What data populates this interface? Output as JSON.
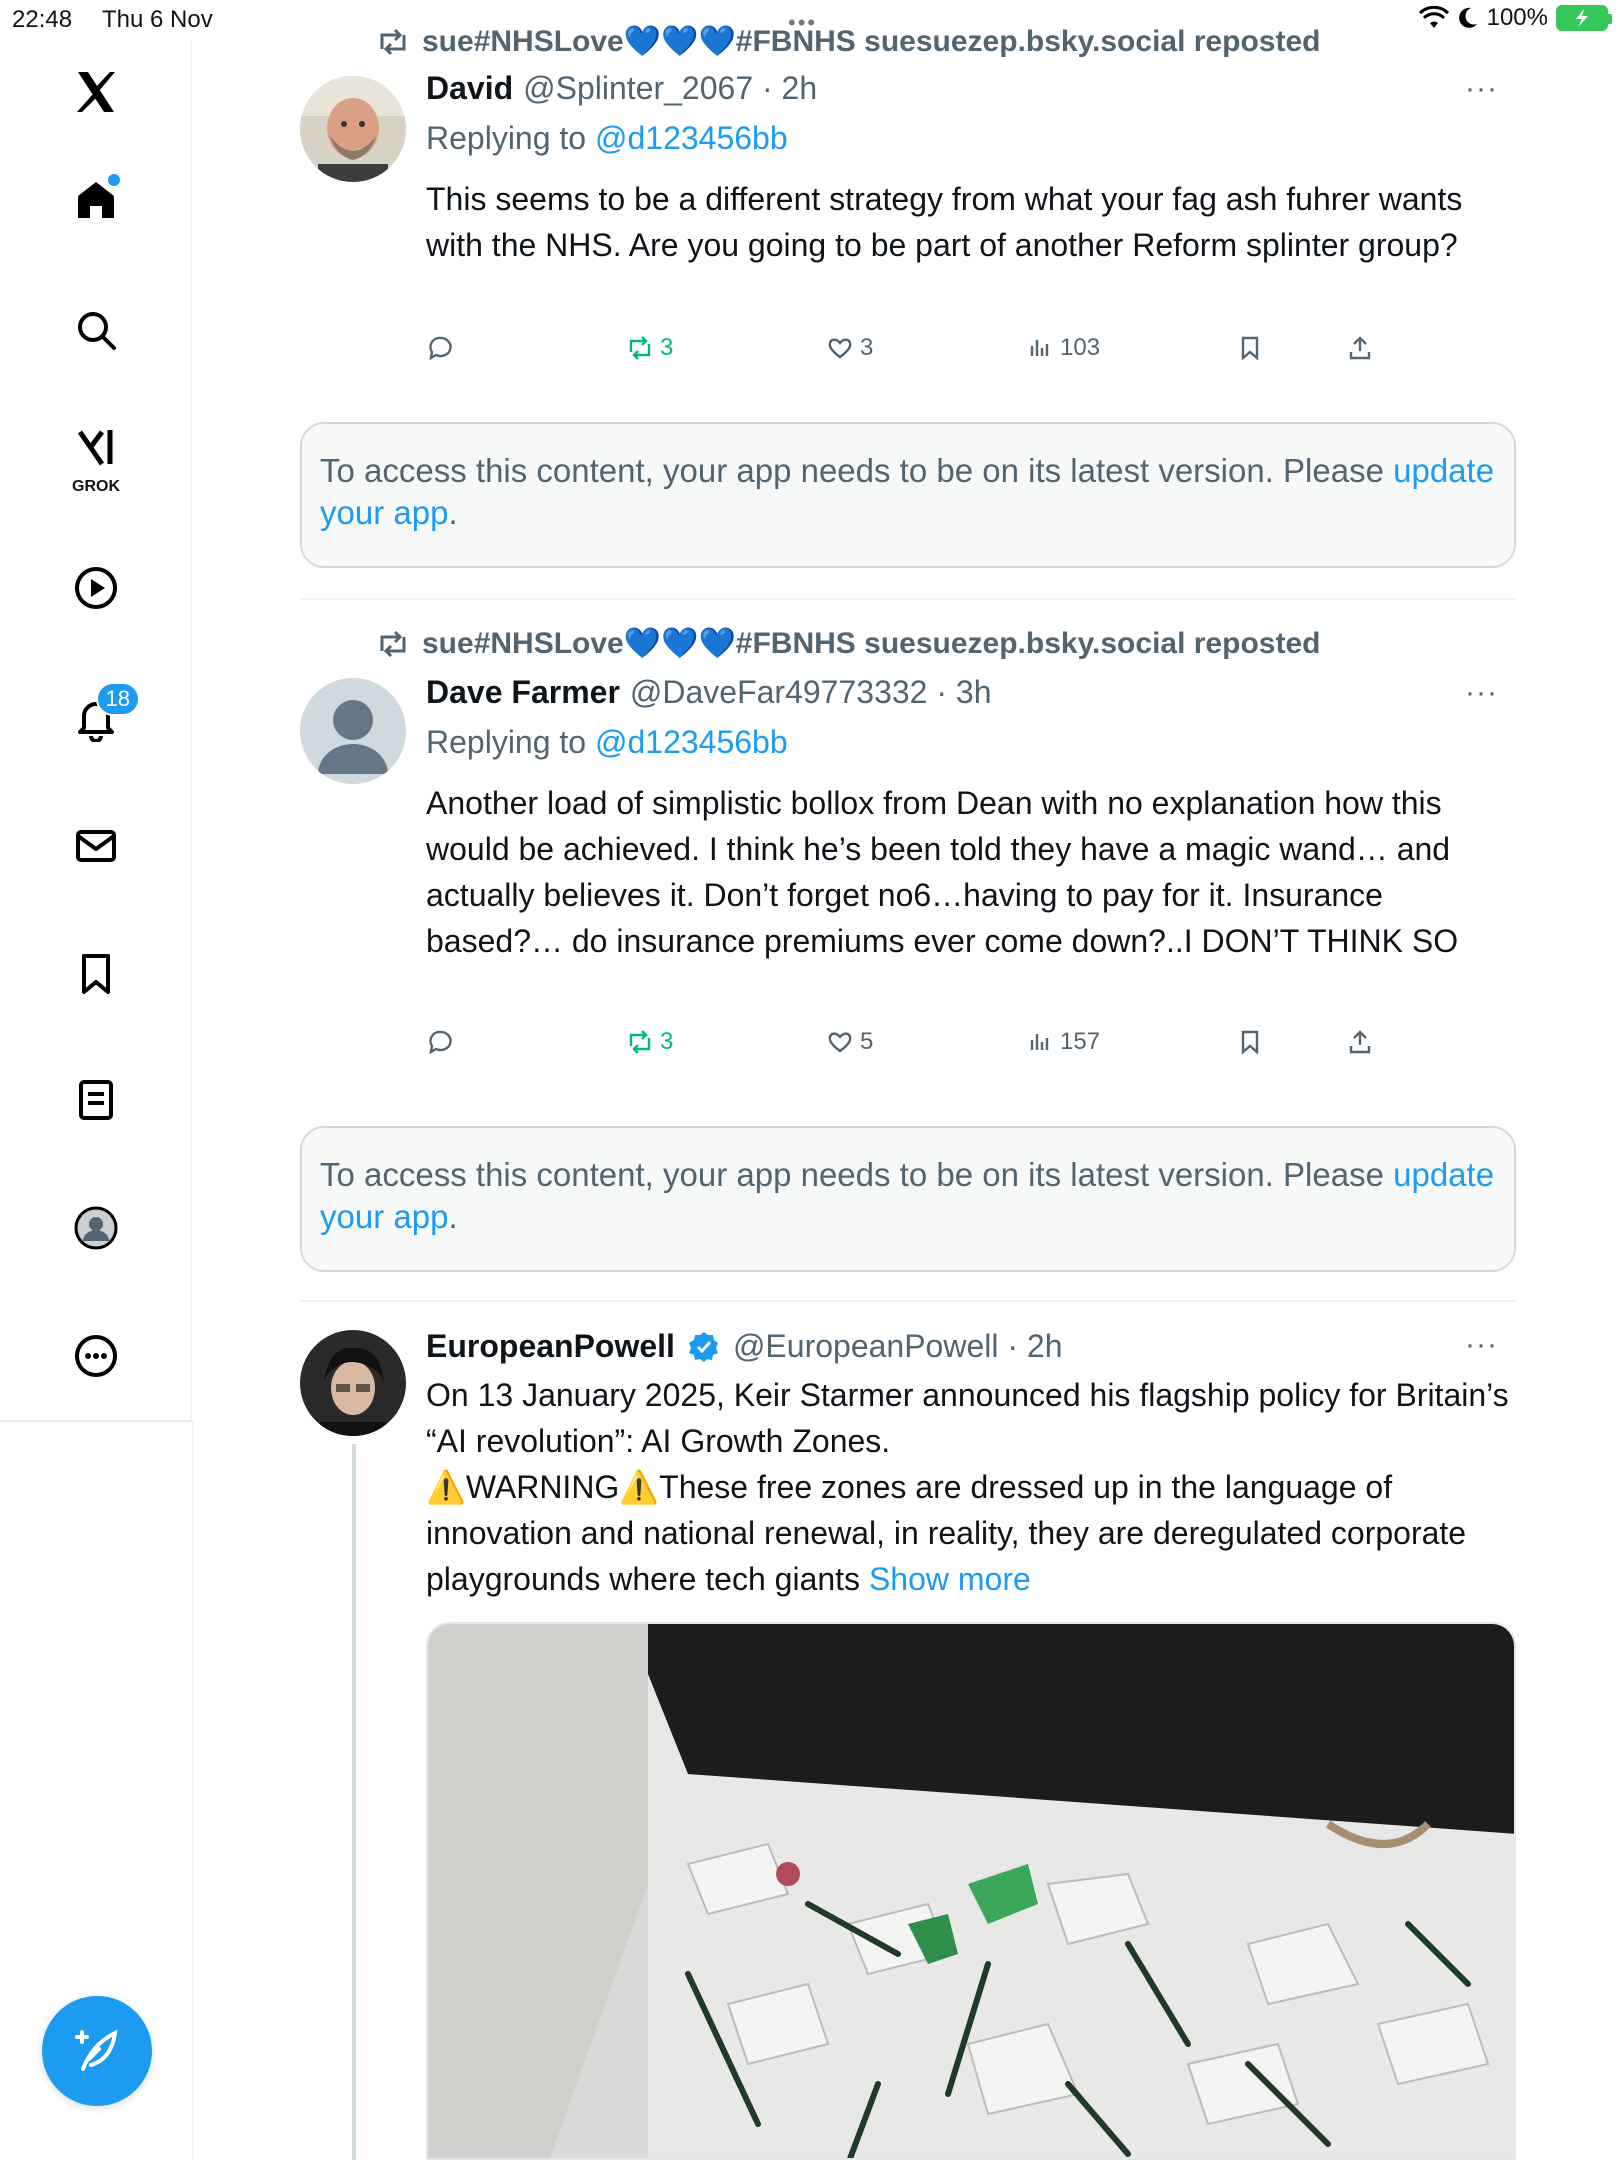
{
  "status_bar": {
    "time": "22:48",
    "date": "Thu 6 Nov",
    "multitask": "•••",
    "battery_text": "100%"
  },
  "sidebar": {
    "logo": "x-logo-icon",
    "items": [
      {
        "icon": "home-icon",
        "label": "Home"
      },
      {
        "icon": "search-icon",
        "label": "Search"
      },
      {
        "icon": "grok-icon",
        "label": "GROK"
      },
      {
        "icon": "video-icon",
        "label": "Video"
      },
      {
        "icon": "bell-icon",
        "label": "Notifications",
        "badge": "18"
      },
      {
        "icon": "mail-icon",
        "label": "Messages"
      },
      {
        "icon": "bookmark-icon",
        "label": "Bookmarks"
      },
      {
        "icon": "list-icon",
        "label": "Lists"
      },
      {
        "icon": "profile-icon",
        "label": "Profile"
      },
      {
        "icon": "more-icon",
        "label": "More"
      }
    ],
    "compose": "compose-icon"
  },
  "colors": {
    "accent": "#1d9bf0",
    "repost_green": "#00ba7c",
    "muted": "#536471"
  },
  "feed": {
    "posts": [
      {
        "repost_by": "sue#NHSLove💙💙💙#FBNHS suesuezep.bsky.social reposted",
        "name": "David",
        "handle": "@Splinter_2067 · 2h",
        "reply_prefix": "Replying to ",
        "reply_to": "@d123456bb",
        "text": "This seems to be a different strategy from what your fag ash fuhrer wants with the NHS. Are you going to be part of another Reform splinter group?",
        "reposts": "3",
        "likes": "3",
        "views": "103"
      },
      {
        "repost_by": "sue#NHSLove💙💙💙#FBNHS suesuezep.bsky.social reposted",
        "name": "Dave Farmer",
        "handle": "@DaveFar49773332 · 3h",
        "reply_prefix": "Replying to ",
        "reply_to": "@d123456bb",
        "text": "Another load of simplistic bollox from Dean with no explanation how this would be achieved. I think he’s been told they have a magic wand… and actually believes it.  Don’t forget no6…having to pay for it. Insurance based?… do insurance premiums ever come down?..I DON’T THINK SO",
        "reposts": "3",
        "likes": "5",
        "views": "157"
      },
      {
        "name": "EuropeanPowell",
        "handle": "@EuropeanPowell · 2h",
        "text_lines": [
          "On 13 January 2025, Keir Starmer announced his flagship policy for Britain’s “AI revolution”: AI Growth Zones.",
          "⚠️WARNING⚠️These free zones are dressed up in the language of innovation and national renewal, in reality, they are deregulated corporate playgrounds where tech giants "
        ],
        "show_more": "Show more"
      }
    ],
    "notice": {
      "text": "To access this content, your app needs to be on its latest version. Please ",
      "link": "update your app",
      "end": "."
    },
    "more_label": "···"
  }
}
